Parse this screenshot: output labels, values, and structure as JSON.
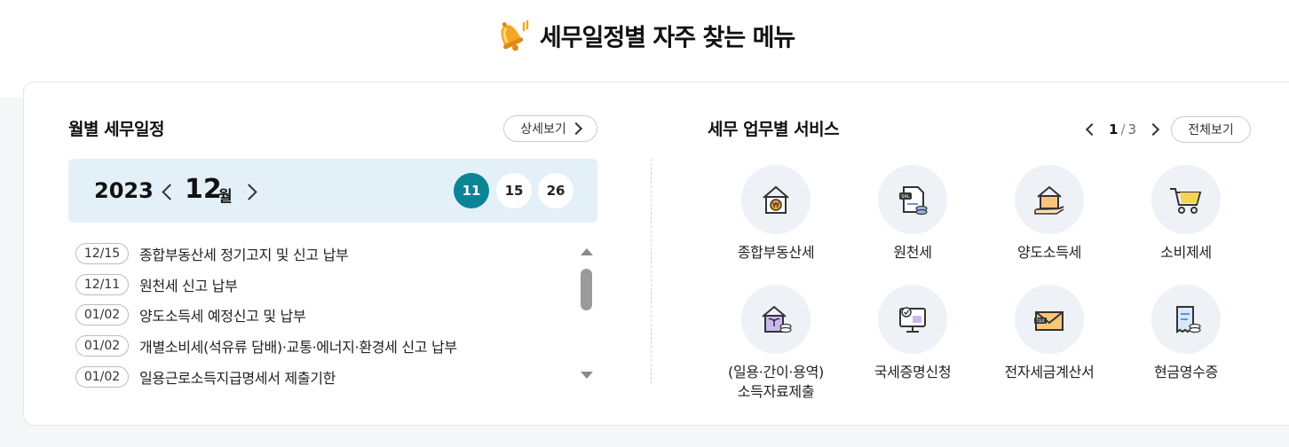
{
  "header": {
    "title": "세무일정별 자주 찾는 메뉴",
    "icon": "bell-icon"
  },
  "schedule": {
    "title": "월별 세무일정",
    "more_label": "상세보기",
    "year": "2023",
    "month": "12",
    "month_unit": "월",
    "days": [
      "11",
      "15",
      "26"
    ],
    "active_day": "11",
    "items": [
      {
        "date": "12/15",
        "text": "종합부동산세 정기고지 및 신고 납부"
      },
      {
        "date": "12/11",
        "text": "원천세 신고 납부"
      },
      {
        "date": "01/02",
        "text": "양도소득세 예정신고 및 납부"
      },
      {
        "date": "01/02",
        "text": "개별소비세(석유류 담배)·교통·에너지·환경세 신고 납부"
      },
      {
        "date": "01/02",
        "text": "일용근로소득지급명세서 제출기한"
      }
    ]
  },
  "services": {
    "title": "세무 업무별 서비스",
    "page_current": "1",
    "page_sep": "/",
    "page_total": "3",
    "view_all_label": "전체보기",
    "items": [
      {
        "label": "종합부동산세",
        "icon": "house-won-icon"
      },
      {
        "label": "원천세",
        "icon": "salary-document-icon"
      },
      {
        "label": "양도소득세",
        "icon": "house-hand-icon"
      },
      {
        "label": "소비제세",
        "icon": "shopping-cart-icon"
      },
      {
        "label": "(일용·간이·용역)",
        "label2": "소득자료제출",
        "icon": "house-plant-coins-icon"
      },
      {
        "label": "국세증명신청",
        "icon": "certificate-monitor-icon"
      },
      {
        "label": "전자세금계산서",
        "icon": "tax-envelope-icon"
      },
      {
        "label": "현금영수증",
        "icon": "receipt-coins-icon"
      }
    ]
  },
  "colors": {
    "accent": "#0b8496",
    "month_bg": "#e3f0f8",
    "icon_bg": "#eef1f6",
    "bell": "#f5a623"
  }
}
